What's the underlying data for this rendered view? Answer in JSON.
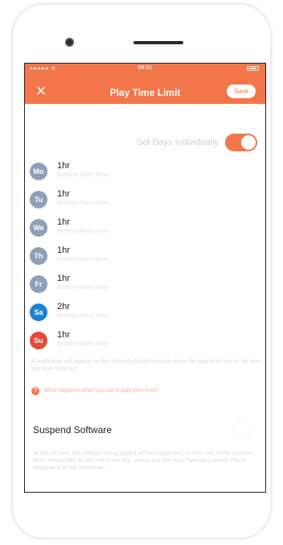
{
  "status_bar": {
    "time": "09:41",
    "signal": "●●●●● ᯤ"
  },
  "header": {
    "close_icon": "×",
    "title": "Play Time Limit",
    "save_label": "Save"
  },
  "toggle": {
    "label": "Set Days Individually",
    "on": true
  },
  "days": [
    {
      "abbr": "Mo",
      "limit": "1hr",
      "sub": "Bedtime Alarm None",
      "color": "#8ea0b8"
    },
    {
      "abbr": "Tu",
      "limit": "1hr",
      "sub": "Bedtime Alarm None",
      "color": "#8ea0b8"
    },
    {
      "abbr": "We",
      "limit": "1hr",
      "sub": "Bedtime Alarm None",
      "color": "#8ea0b8"
    },
    {
      "abbr": "Th",
      "limit": "1hr",
      "sub": "Bedtime Alarm None",
      "color": "#8ea0b8"
    },
    {
      "abbr": "Fr",
      "limit": "1hr",
      "sub": "Bedtime Alarm None",
      "color": "#8ea0b8"
    },
    {
      "abbr": "Sa",
      "limit": "2hr",
      "sub": "Bedtime Alarm None",
      "color": "#1d82d4"
    },
    {
      "abbr": "Su",
      "limit": "1hr",
      "sub": "Bedtime Alarm None",
      "color": "#e5493a"
    }
  ],
  "note": "A notification will appear on the Nintendo Switch console when the play-time limit or set time has been reached.",
  "help": {
    "icon": "?",
    "link": "What happens when you set a play-time limit?"
  },
  "suspend": {
    "title": "Suspend Software",
    "on": false,
    "description": "At the set time, the software being played will be suspended. Further use of the console won't be possible for the rest of the day, unless you use your Parental Controls PIN to temporarily lift the restriction."
  },
  "colors": {
    "accent": "#f3764a"
  }
}
